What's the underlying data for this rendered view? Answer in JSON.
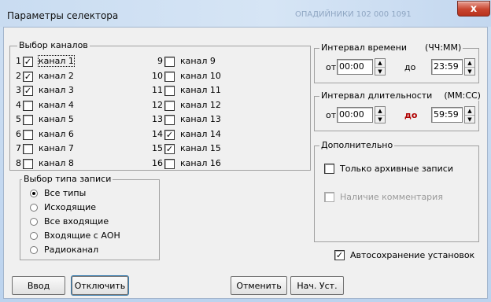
{
  "window": {
    "title": "Параметры селектора",
    "ghost_text": "ОПАДИЙНИКИ 102 000 1091",
    "close_glyph": "x"
  },
  "channels": {
    "title": "Выбор каналов",
    "items": [
      {
        "num": "1",
        "label": "канал 1",
        "checked": true
      },
      {
        "num": "2",
        "label": "канал 2",
        "checked": true
      },
      {
        "num": "3",
        "label": "канал 3",
        "checked": true
      },
      {
        "num": "4",
        "label": "канал 4",
        "checked": false
      },
      {
        "num": "5",
        "label": "канал 5",
        "checked": false
      },
      {
        "num": "6",
        "label": "канал 6",
        "checked": false
      },
      {
        "num": "7",
        "label": "канал 7",
        "checked": false
      },
      {
        "num": "8",
        "label": "канал 8",
        "checked": false
      },
      {
        "num": "9",
        "label": "канал 9",
        "checked": false
      },
      {
        "num": "10",
        "label": "канал 10",
        "checked": false
      },
      {
        "num": "11",
        "label": "канал 11",
        "checked": false
      },
      {
        "num": "12",
        "label": "канал 12",
        "checked": false
      },
      {
        "num": "13",
        "label": "канал 13",
        "checked": false
      },
      {
        "num": "14",
        "label": "канал 14",
        "checked": true
      },
      {
        "num": "15",
        "label": "канал 15",
        "checked": true
      },
      {
        "num": "16",
        "label": "канал 16",
        "checked": false
      }
    ]
  },
  "record_type": {
    "title": "Выбор типа записи",
    "options": [
      {
        "label": "Все типы",
        "selected": true
      },
      {
        "label": "Исходящие",
        "selected": false
      },
      {
        "label": "Все входящие",
        "selected": false
      },
      {
        "label": "Входящие с АОН",
        "selected": false
      },
      {
        "label": "Радиоканал",
        "selected": false
      }
    ]
  },
  "time_interval": {
    "title": "Интервал времени",
    "format": "(ЧЧ:ММ)",
    "from_label": "от",
    "from_value": "00:00",
    "to_label": "до",
    "to_value": "23:59"
  },
  "duration_interval": {
    "title": "Интервал длительности",
    "format": "(ММ:СС)",
    "from_label": "от",
    "from_value": "00:00",
    "to_label": "до",
    "to_value": "59:59"
  },
  "additional": {
    "title": "Дополнительно",
    "archive_only": {
      "label": "Только архивные записи",
      "checked": false
    },
    "has_comment": {
      "label": "Наличие комментария",
      "checked": false,
      "disabled": true
    }
  },
  "autosave": {
    "label": "Автосохранение установок",
    "checked": true
  },
  "buttons": {
    "enter": "Ввод",
    "disable": "Отключить",
    "cancel": "Отменить",
    "defaults": "Нач. Уст."
  },
  "glyphs": {
    "check": "✓",
    "spin_up": "▲",
    "spin_down": "▼"
  }
}
